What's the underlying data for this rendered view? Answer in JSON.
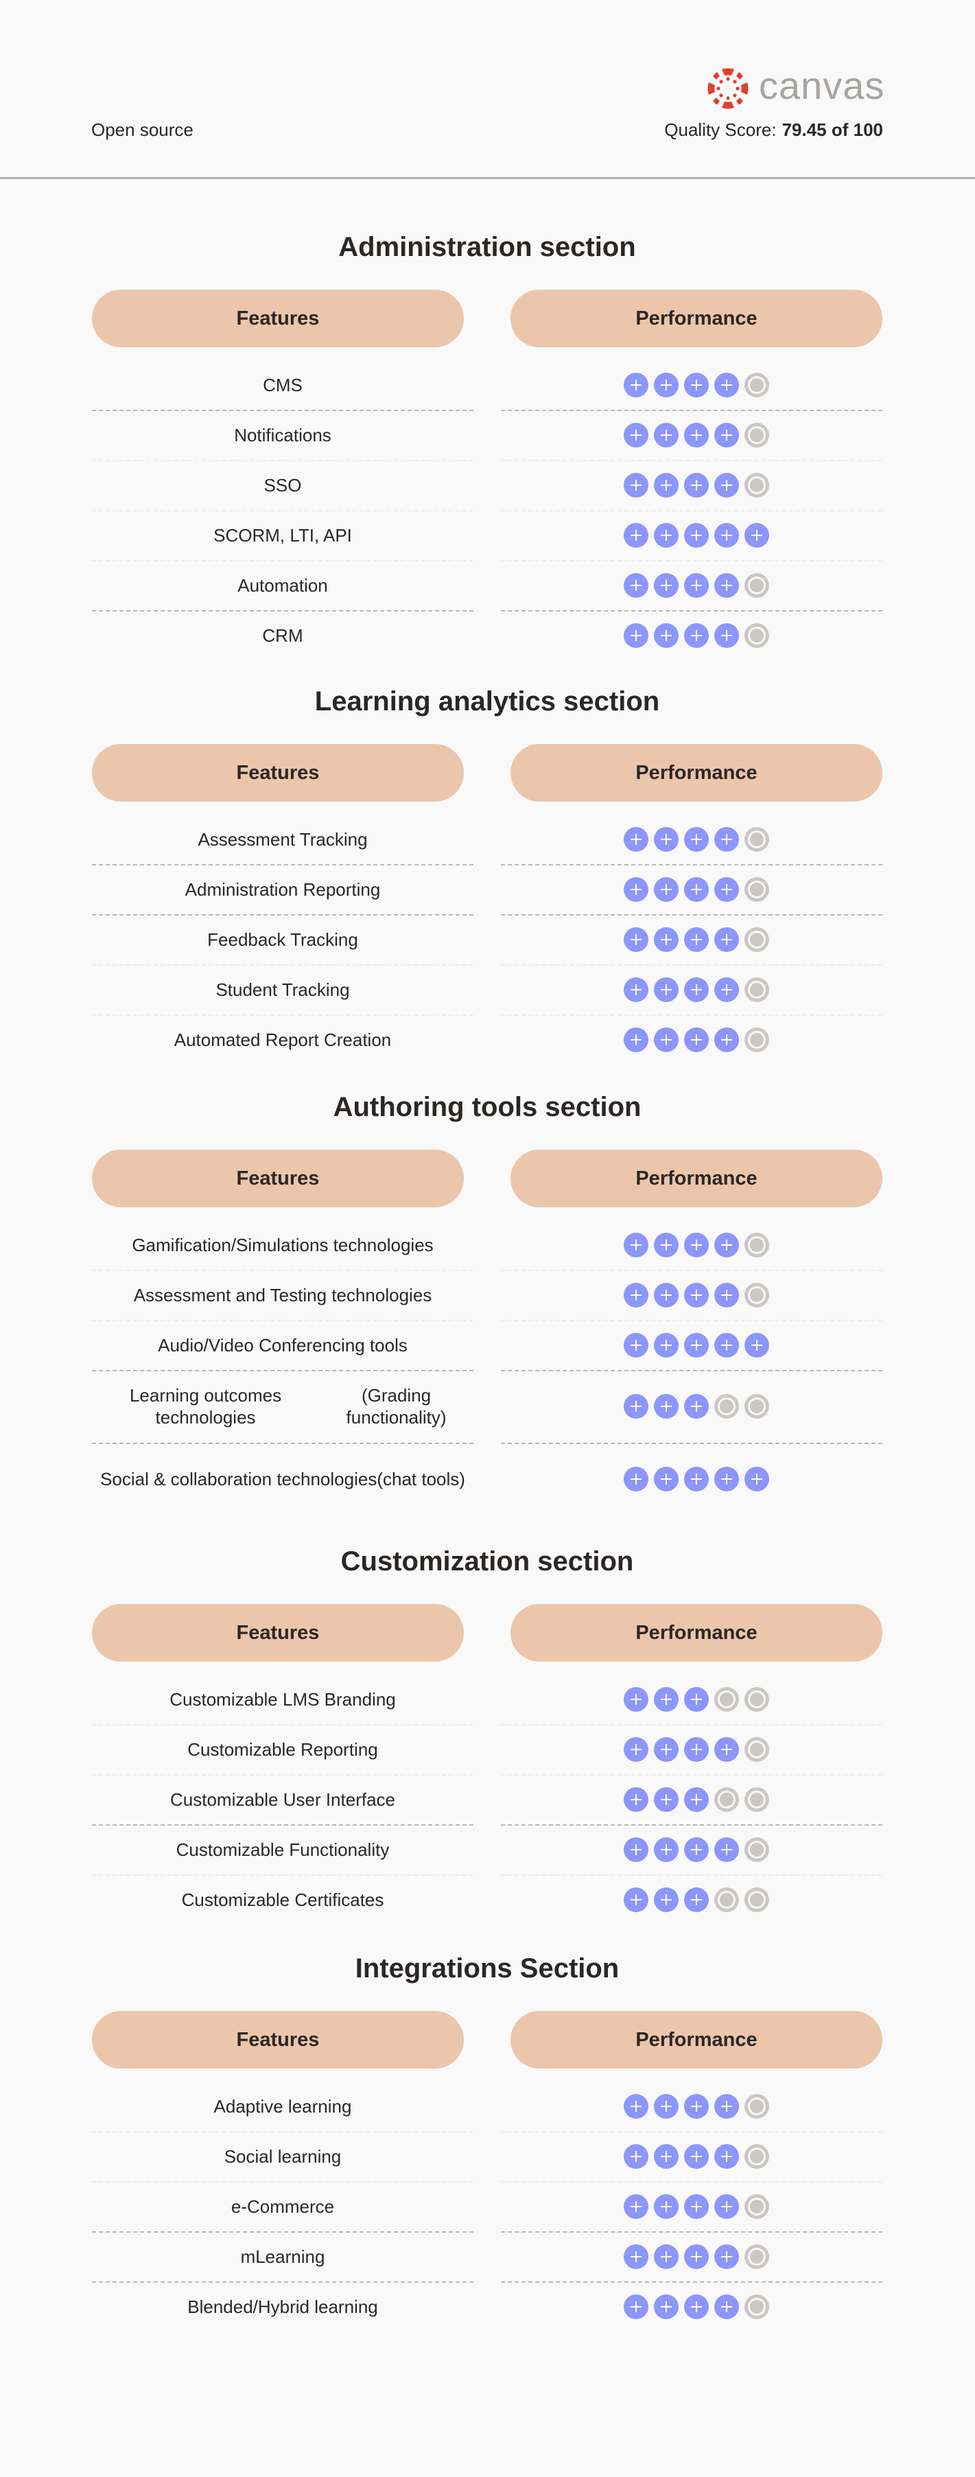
{
  "header": {
    "license": "Open source",
    "brand": "canvas",
    "quality_label": "Quality Score:",
    "quality_value": "79.45 of 100",
    "brand_color": "#e13f2b"
  },
  "colors": {
    "pill": "#ebc6ab",
    "rating_on": "#8c96fb",
    "rating_off": "#cbc7c3"
  },
  "rating_max": 5,
  "sections": [
    {
      "title": "Administration section",
      "features_label": "Features",
      "performance_label": "Performance",
      "rows": [
        {
          "feature": [
            "CMS"
          ],
          "rating": 4,
          "separator": "dashed"
        },
        {
          "feature": [
            "Notifications"
          ],
          "rating": 4,
          "separator": "faint"
        },
        {
          "feature": [
            "SSO"
          ],
          "rating": 4,
          "separator": "faint"
        },
        {
          "feature": [
            "SCORM, LTI, API"
          ],
          "rating": 5,
          "separator": "faint"
        },
        {
          "feature": [
            "Automation"
          ],
          "rating": 4,
          "separator": "dashed"
        },
        {
          "feature": [
            "CRM"
          ],
          "rating": 4,
          "separator": "none"
        }
      ]
    },
    {
      "title": "Learning analytics section",
      "features_label": "Features",
      "performance_label": "Performance",
      "rows": [
        {
          "feature": [
            "Assessment Tracking"
          ],
          "rating": 4,
          "separator": "dashed"
        },
        {
          "feature": [
            "Administration Reporting"
          ],
          "rating": 4,
          "separator": "dashed"
        },
        {
          "feature": [
            "Feedback Tracking"
          ],
          "rating": 4,
          "separator": "faint"
        },
        {
          "feature": [
            "Student Tracking"
          ],
          "rating": 4,
          "separator": "faint"
        },
        {
          "feature": [
            "Automated Report Creation"
          ],
          "rating": 4,
          "separator": "none"
        }
      ]
    },
    {
      "title": "Authoring tools section",
      "features_label": "Features",
      "performance_label": "Performance",
      "rows": [
        {
          "feature": [
            "Gamification/Simulations technologies"
          ],
          "rating": 4,
          "separator": "faint"
        },
        {
          "feature": [
            "Assessment and Testing technologies"
          ],
          "rating": 4,
          "separator": "faint"
        },
        {
          "feature": [
            "Audio/Video Conferencing tools"
          ],
          "rating": 5,
          "separator": "dashed"
        },
        {
          "feature": [
            "Learning outcomes technologies",
            "(Grading functionality)"
          ],
          "rating": 3,
          "separator": "dashed"
        },
        {
          "feature": [
            "Social & collaboration technologies",
            "(chat tools)"
          ],
          "rating": 5,
          "separator": "none"
        }
      ]
    },
    {
      "title": "Customization section",
      "features_label": "Features",
      "performance_label": "Performance",
      "rows": [
        {
          "feature": [
            "Customizable LMS Branding"
          ],
          "rating": 3,
          "separator": "faint"
        },
        {
          "feature": [
            "Customizable Reporting"
          ],
          "rating": 4,
          "separator": "faint"
        },
        {
          "feature": [
            "Customizable User Interface"
          ],
          "rating": 3,
          "separator": "dashed"
        },
        {
          "feature": [
            "Customizable Functionality"
          ],
          "rating": 4,
          "separator": "faint"
        },
        {
          "feature": [
            "Customizable Certificates"
          ],
          "rating": 3,
          "separator": "none"
        }
      ]
    },
    {
      "title": "Integrations Section",
      "features_label": "Features",
      "performance_label": "Performance",
      "rows": [
        {
          "feature": [
            "Adaptive learning"
          ],
          "rating": 4,
          "separator": "faint"
        },
        {
          "feature": [
            "Social learning"
          ],
          "rating": 4,
          "separator": "faint"
        },
        {
          "feature": [
            "e-Commerce"
          ],
          "rating": 4,
          "separator": "dashed"
        },
        {
          "feature": [
            "mLearning"
          ],
          "rating": 4,
          "separator": "dashed"
        },
        {
          "feature": [
            "Blended/Hybrid learning"
          ],
          "rating": 4,
          "separator": "none"
        }
      ]
    }
  ]
}
